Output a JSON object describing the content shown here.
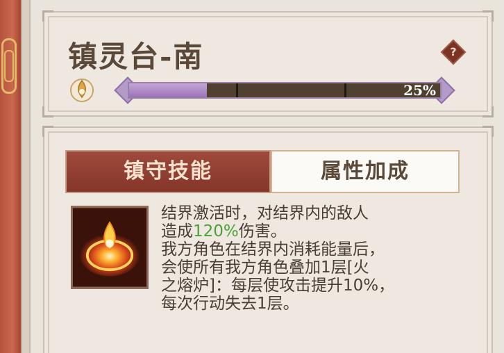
{
  "station": {
    "title": "镇灵台-南",
    "help_label": "?",
    "progress_percent": 25,
    "progress_label": "25%"
  },
  "tabs": [
    {
      "label": "镇守技能",
      "active": true
    },
    {
      "label": "属性加成",
      "active": false
    }
  ],
  "skill": {
    "icon": "fire-ring-icon",
    "desc_line1": "结界激活时，对结界内的敌人",
    "desc_line2_pre": "造成",
    "desc_line2_highlight": "120%",
    "desc_line2_post": "伤害。",
    "desc_line3": "我方角色在结界内消耗能量后，",
    "desc_line4": "会使所有我方角色叠加1层[火",
    "desc_line5": "之熔炉]：每层使攻击提升10%，",
    "desc_line6": "每次行动失去1层。"
  },
  "colors": {
    "highlight": "#4aa236",
    "active_tab": "#843628",
    "progress_fill": "#9a72b6"
  }
}
